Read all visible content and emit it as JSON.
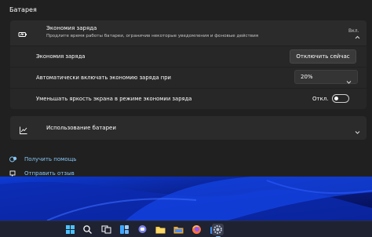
{
  "section": {
    "title": "Батарея"
  },
  "battery_saver": {
    "title": "Экономия заряда",
    "description": "Продлите время работы батареи, ограничив некоторые уведомления и фоновые действия",
    "status": "Вкл.",
    "rows": {
      "saver": {
        "label": "Экономия заряда",
        "button": "Отключить сейчас"
      },
      "auto": {
        "label": "Автоматически включать экономию заряда при",
        "value": "20%"
      },
      "brightness": {
        "label": "Уменьшать яркость экрана в режиме экономии заряда",
        "toggle_text": "Откл.",
        "toggle_on": false
      }
    }
  },
  "battery_usage": {
    "title": "Использование батареи"
  },
  "links": {
    "help": "Получить помощь",
    "feedback": "Отправить отзыв"
  },
  "taskbar": {
    "apps": [
      "start-icon",
      "search-icon",
      "task-view-icon",
      "widgets-icon",
      "chat-icon",
      "file-explorer-icon",
      "folder-icon",
      "firefox-icon",
      "store-icon",
      "settings-icon"
    ],
    "active": "settings-icon"
  },
  "colors": {
    "accent": "#86c6f5",
    "wallpaper": "#0a1f8a"
  }
}
